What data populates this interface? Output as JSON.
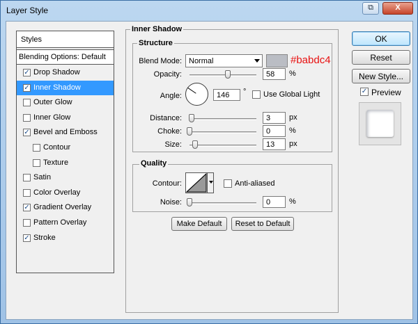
{
  "window": {
    "title": "Layer Style",
    "restore_icon": "restore-icon",
    "close_label": "X"
  },
  "styles": {
    "header": "Styles",
    "blending_options": "Blending Options: Default",
    "items": [
      {
        "label": "Drop Shadow",
        "checked": true,
        "indent": false,
        "selected": false
      },
      {
        "label": "Inner Shadow",
        "checked": true,
        "indent": false,
        "selected": true
      },
      {
        "label": "Outer Glow",
        "checked": false,
        "indent": false,
        "selected": false
      },
      {
        "label": "Inner Glow",
        "checked": false,
        "indent": false,
        "selected": false
      },
      {
        "label": "Bevel and Emboss",
        "checked": true,
        "indent": false,
        "selected": false
      },
      {
        "label": "Contour",
        "checked": false,
        "indent": true,
        "selected": false
      },
      {
        "label": "Texture",
        "checked": false,
        "indent": true,
        "selected": false
      },
      {
        "label": "Satin",
        "checked": false,
        "indent": false,
        "selected": false
      },
      {
        "label": "Color Overlay",
        "checked": false,
        "indent": false,
        "selected": false
      },
      {
        "label": "Gradient Overlay",
        "checked": true,
        "indent": false,
        "selected": false
      },
      {
        "label": "Pattern Overlay",
        "checked": false,
        "indent": false,
        "selected": false
      },
      {
        "label": "Stroke",
        "checked": true,
        "indent": false,
        "selected": false
      }
    ]
  },
  "inner_shadow": {
    "title": "Inner Shadow",
    "structure": {
      "title": "Structure",
      "blend_mode_label": "Blend Mode:",
      "blend_mode_value": "Normal",
      "color": "#babdc4",
      "color_text": "#babdc4",
      "opacity_label": "Opacity:",
      "opacity_value": "58",
      "opacity_unit": "%",
      "angle_label": "Angle:",
      "angle_value": "146",
      "angle_unit": "°",
      "use_global_light_label": "Use Global Light",
      "use_global_light": false,
      "distance_label": "Distance:",
      "distance_value": "3",
      "distance_unit": "px",
      "choke_label": "Choke:",
      "choke_value": "0",
      "choke_unit": "%",
      "size_label": "Size:",
      "size_value": "13",
      "size_unit": "px"
    },
    "quality": {
      "title": "Quality",
      "contour_label": "Contour:",
      "anti_aliased_label": "Anti-aliased",
      "anti_aliased": false,
      "noise_label": "Noise:",
      "noise_value": "0",
      "noise_unit": "%"
    },
    "make_default_label": "Make Default",
    "reset_to_default_label": "Reset to Default"
  },
  "right": {
    "ok_label": "OK",
    "reset_label": "Reset",
    "new_style_label": "New Style...",
    "preview_label": "Preview",
    "preview_checked": true
  },
  "colors": {
    "selection": "#3399ff",
    "accent_text": "#e81010"
  }
}
